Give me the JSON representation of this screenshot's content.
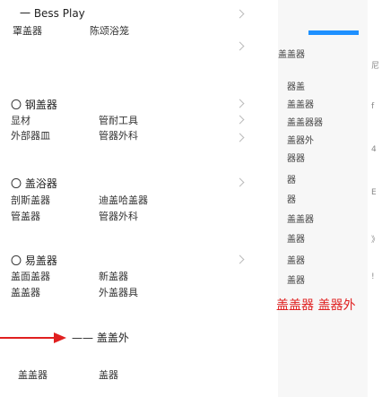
{
  "top": {
    "title": "一 Bess Play",
    "left_label": "罩盖器",
    "right_label": "陈颂浴笼"
  },
  "sections": [
    {
      "title": "〇 钢盖器",
      "rows": [
        [
          "显材",
          "管耐工具"
        ],
        [
          "外部器皿",
          "管器外科"
        ]
      ]
    },
    {
      "title": "〇 盖浴器",
      "rows": [
        [
          "剖斯盖器",
          "迪盖哈盖器"
        ],
        [
          "管盖器",
          "管器外科"
        ]
      ]
    },
    {
      "title": "〇 易盖器",
      "rows": [
        [
          "盖面盖器",
          "新盖器"
        ],
        [
          "盖盖器",
          "外盖器具"
        ]
      ]
    }
  ],
  "bottom": {
    "label": "—— 盖盖外",
    "sub_left": "盖盖器",
    "sub_right": "盖器"
  },
  "right_panel": {
    "top_label": "盖盖器",
    "items": [
      "器盖",
      "盖盖器",
      "盖盖器器",
      "盖器外",
      "器器",
      "器",
      "器",
      "盖盖器",
      "盖器",
      "盖器",
      "盖器"
    ],
    "bottom_big_text": "盖盖器 盖器外",
    "colors": {
      "accent": "#1e90ff",
      "red_mark": "#e02020"
    }
  },
  "far_right_marks": [
    "尼",
    "f",
    "4",
    "E",
    "》",
    "!"
  ]
}
